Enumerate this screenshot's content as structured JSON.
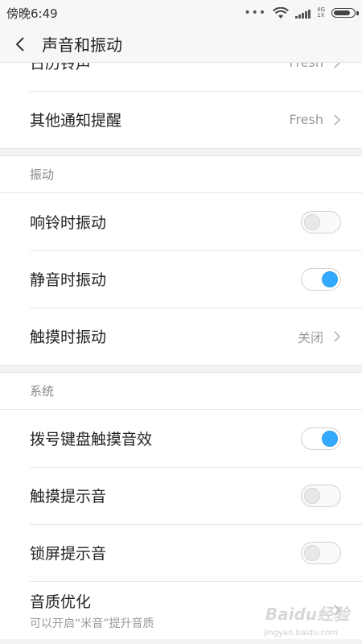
{
  "status_bar": {
    "time": "傍晚6:49",
    "dots": "•••",
    "net_top": "4G",
    "net_bottom": "1X"
  },
  "header": {
    "title": "声音和振动",
    "back_icon": "chevron-left-icon"
  },
  "partial_row": {
    "label": "日历铃声",
    "value": "Fresh"
  },
  "top_group": {
    "other_notify": {
      "label": "其他通知提醒",
      "value": "Fresh"
    }
  },
  "vibrate_section": {
    "header": "振动",
    "ring_vibrate": {
      "label": "响铃时振动",
      "on": false
    },
    "silent_vibrate": {
      "label": "静音时振动",
      "on": true
    },
    "touch_vibrate": {
      "label": "触摸时振动",
      "value": "关闭"
    }
  },
  "system_section": {
    "header": "系统",
    "dialpad_sound": {
      "label": "拨号键盘触摸音效",
      "on": true
    },
    "touch_sound": {
      "label": "触摸提示音",
      "on": false
    },
    "lock_sound": {
      "label": "锁屏提示音",
      "on": false
    },
    "audio_opt": {
      "label": "音质优化",
      "sub": "可以开启“米音”提升音质"
    }
  },
  "watermark": {
    "text": "Baidu经验",
    "sub": "jingyan.baidu.com"
  },
  "colors": {
    "accent": "#33aaff",
    "background": "#f2f2f2"
  }
}
